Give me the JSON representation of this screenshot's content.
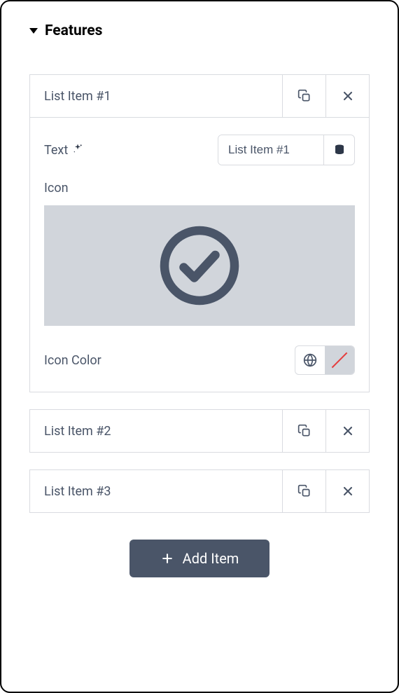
{
  "section": {
    "title": "Features"
  },
  "items": [
    {
      "label": "List Item #1",
      "expanded": true
    },
    {
      "label": "List Item #2",
      "expanded": false
    },
    {
      "label": "List Item #3",
      "expanded": false
    }
  ],
  "expanded_item": {
    "text_label": "Text",
    "text_value": "List Item #1",
    "icon_label": "Icon",
    "icon_color_label": "Icon Color"
  },
  "add_button_label": "Add Item"
}
